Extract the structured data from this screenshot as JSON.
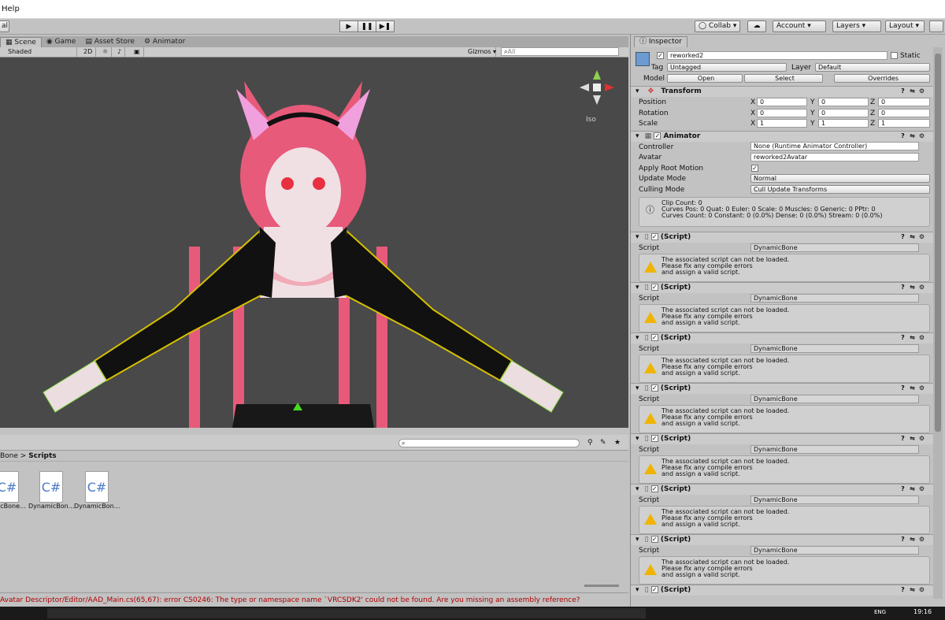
{
  "menubar": {
    "help": "Help"
  },
  "toolbar": {
    "left_partial": "al",
    "play": "▶",
    "pause": "❚❚",
    "step": "▶❚",
    "collab": "◯ Collab ▾",
    "cloud": "☁",
    "account": "Account ▾",
    "layers": "Layers ▾",
    "layout": "Layout ▾"
  },
  "tabs": {
    "scene": "Scene",
    "game": "Game",
    "asset_store": "Asset Store",
    "animator": "Animator",
    "inspector": "Inspector"
  },
  "scenebar": {
    "shading": "Shaded",
    "mode2d": "2D",
    "gizmos": "Gizmos ▾",
    "search_placeholder": "All"
  },
  "scene": {
    "persp_label": "Iso"
  },
  "project": {
    "breadcrumb_parent": "Bone",
    "breadcrumb_child": "Scripts",
    "files": [
      {
        "name": "DynamicBone...",
        "partial": "amicBone...",
        "icon": "C#"
      },
      {
        "name": "DynamicBon...",
        "icon": "C#"
      },
      {
        "name": "DynamicBon...",
        "icon": "C#"
      }
    ]
  },
  "console": {
    "message": "Avatar Descriptor/Editor/AAD_Main.cs(65,67): error CS0246: The type or namespace name `VRCSDK2' could not be found. Are you missing an assembly reference?"
  },
  "taskbar": {
    "time": "19:16",
    "lang": "ENG"
  },
  "inspector": {
    "object_name": "reworked2",
    "static_label": "Static",
    "tag_label": "Tag",
    "tag_value": "Untagged",
    "layer_label": "Layer",
    "layer_value": "Default",
    "model_label": "Model",
    "open": "Open",
    "select": "Select",
    "overrides": "Overrides",
    "transform": {
      "title": "Transform",
      "position": "Position",
      "rotation": "Rotation",
      "scale": "Scale",
      "pos": [
        "0",
        "0",
        "0"
      ],
      "rot": [
        "0",
        "0",
        "0"
      ],
      "scl": [
        "1",
        "1",
        "1"
      ],
      "x": "X",
      "y": "Y",
      "z": "Z"
    },
    "animator": {
      "title": "Animator",
      "controller_label": "Controller",
      "controller_value": "None (Runtime Animator Controller)",
      "avatar_label": "Avatar",
      "avatar_value": "reworked2Avatar",
      "apply_root_label": "Apply Root Motion",
      "update_label": "Update Mode",
      "update_value": "Normal",
      "culling_label": "Culling Mode",
      "culling_value": "Cull Update Transforms",
      "info": "Clip Count: 0\nCurves Pos: 0 Quat: 0 Euler: 0 Scale: 0 Muscles: 0 Generic: 0 PPtr: 0\nCurves Count: 0 Constant: 0 (0.0%) Dense: 0 (0.0%) Stream: 0 (0.0%)"
    },
    "script_title": "(Script)",
    "script_label": "Script",
    "script_value": "DynamicBone",
    "warning": "The associated script can not be loaded.\nPlease fix any compile errors\nand assign a valid script."
  }
}
